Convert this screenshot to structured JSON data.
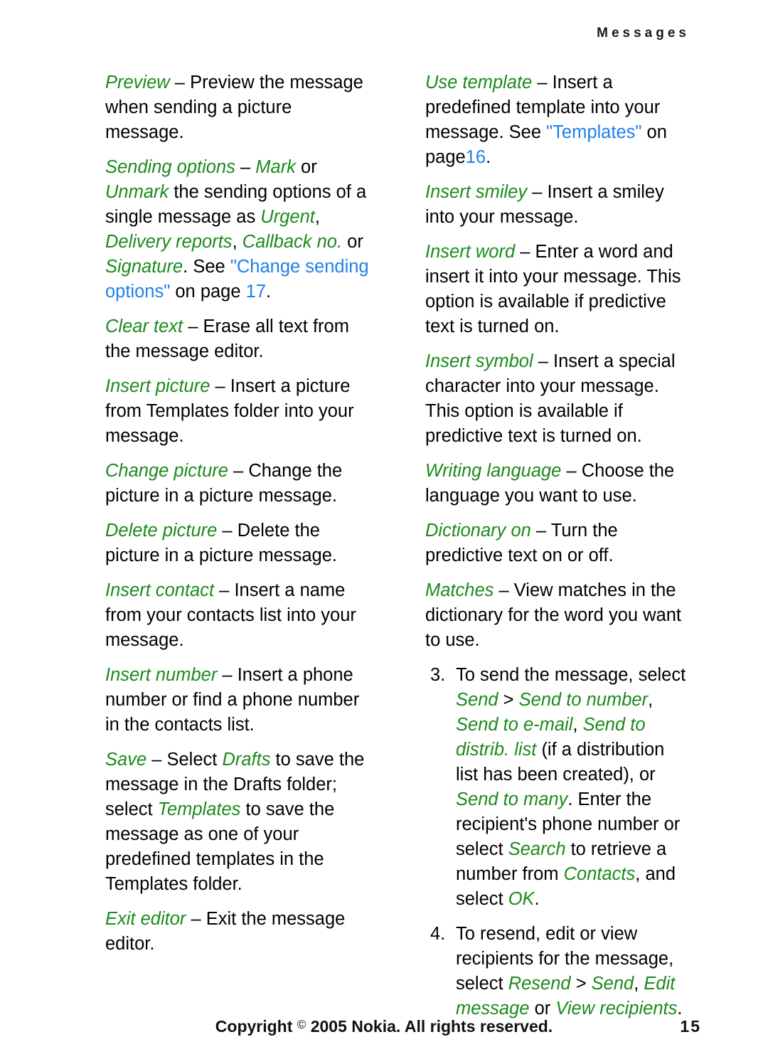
{
  "header": {
    "running_head": "Messages"
  },
  "left_column": {
    "paragraphs": [
      {
        "id": "preview",
        "term": "Preview",
        "dash": " – ",
        "body": "Preview the message when sending a picture message."
      },
      {
        "id": "sending-options",
        "term": "Sending options",
        "dash": " – ",
        "seg1_term": "Mark",
        "seg2": " or ",
        "seg3_term": "Unmark",
        "seg4": " the sending options of a single message as ",
        "seg5_term": "Urgent",
        "seg6": ", ",
        "seg7_term": "Delivery reports",
        "seg8": ", ",
        "seg9_term": "Callback no.",
        "seg10": " or ",
        "seg11_term": "Signature",
        "seg12": ". See ",
        "xref": "\"Change sending options\"",
        "seg13": " on page ",
        "pagenum": "17",
        "seg14": "."
      },
      {
        "id": "clear-text",
        "term": "Clear text",
        "dash": " – ",
        "body": "Erase all text from the message editor."
      },
      {
        "id": "insert-picture",
        "term": "Insert picture",
        "dash": " – ",
        "body": "Insert a picture from Templates folder into your message."
      },
      {
        "id": "change-picture",
        "term": "Change picture",
        "dash": " – ",
        "body": "Change the picture in a picture message."
      },
      {
        "id": "delete-picture",
        "term": "Delete picture",
        "dash": " – ",
        "body": "Delete the picture in a picture message."
      },
      {
        "id": "insert-contact",
        "term": "Insert contact",
        "dash": " – ",
        "body": "Insert a name from your contacts list into your message."
      },
      {
        "id": "insert-number",
        "term": "Insert number",
        "dash": " – ",
        "body": "Insert a phone number or find a phone number in the contacts list."
      },
      {
        "id": "save",
        "term": "Save",
        "dash": " – ",
        "seg1": "Select ",
        "seg2_term": "Drafts",
        "seg3": " to save the message in the Drafts folder; select ",
        "seg4_term": "Templates",
        "seg5": " to save the message as one of your predefined templates in the Templates folder."
      },
      {
        "id": "exit-editor",
        "term": "Exit editor",
        "dash": " – ",
        "body": "Exit the message editor."
      }
    ]
  },
  "right_column": {
    "paragraphs": [
      {
        "id": "use-template",
        "term": "Use template",
        "dash": " – ",
        "seg1": "Insert a predefined template into your message. See ",
        "xref": "\"Templates\"",
        "seg2": " on page",
        "pagenum": "16",
        "seg3": "."
      },
      {
        "id": "insert-smiley",
        "term": "Insert smiley",
        "dash": " – ",
        "body": "Insert a smiley into your message."
      },
      {
        "id": "insert-word",
        "term": "Insert word",
        "dash": " – ",
        "body": "Enter a word and insert it into your message. This option is available if predictive text is turned on."
      },
      {
        "id": "insert-symbol",
        "term": "Insert symbol",
        "dash": " – ",
        "body": "Insert a special character into your message. This option is available if predictive text is turned on."
      },
      {
        "id": "writing-language",
        "term": "Writing language",
        "dash": " – ",
        "body": "Choose the language you want to use."
      },
      {
        "id": "dictionary-on",
        "term": "Dictionary on",
        "dash": " – ",
        "body": "Turn the predictive text on or off."
      },
      {
        "id": "matches",
        "term": "Matches",
        "dash": " – ",
        "body": "View matches in the dictionary for the word you want to use."
      }
    ],
    "steps": [
      {
        "id": "step-3",
        "num": "3.",
        "seg1": "To send the message, select ",
        "t1": "Send",
        "seg2": " > ",
        "t2": "Send to number",
        "seg3": ", ",
        "t3": "Send to e-mail",
        "seg4": ", ",
        "t4": "Send to distrib. list",
        "seg5": " (if a distribution list has been created), or ",
        "t5": "Send to many",
        "seg6": ". Enter the recipient's phone number or select ",
        "t6": "Search",
        "seg7": " to retrieve a number from ",
        "t7": "Contacts",
        "seg8": ", and select ",
        "t8": "OK",
        "seg9": "."
      },
      {
        "id": "step-4",
        "num": "4.",
        "seg1": "To resend, edit or view recipients for the message, select ",
        "t1": "Resend",
        "seg2": " > ",
        "t2": "Send",
        "seg3": ", ",
        "t3": "Edit message",
        "seg4": " or ",
        "t4": "View recipients",
        "seg5": "."
      }
    ]
  },
  "footer": {
    "copyright_pre": "Copyright ",
    "copyright_symbol": "©",
    "copyright_post": " 2005 Nokia. All rights reserved.",
    "page_number": "15"
  },
  "colors": {
    "ui_term_green": "#1c8a1c",
    "hyperlink_blue": "#2080e8",
    "body_text": "#000000",
    "page_background": "#ffffff"
  }
}
